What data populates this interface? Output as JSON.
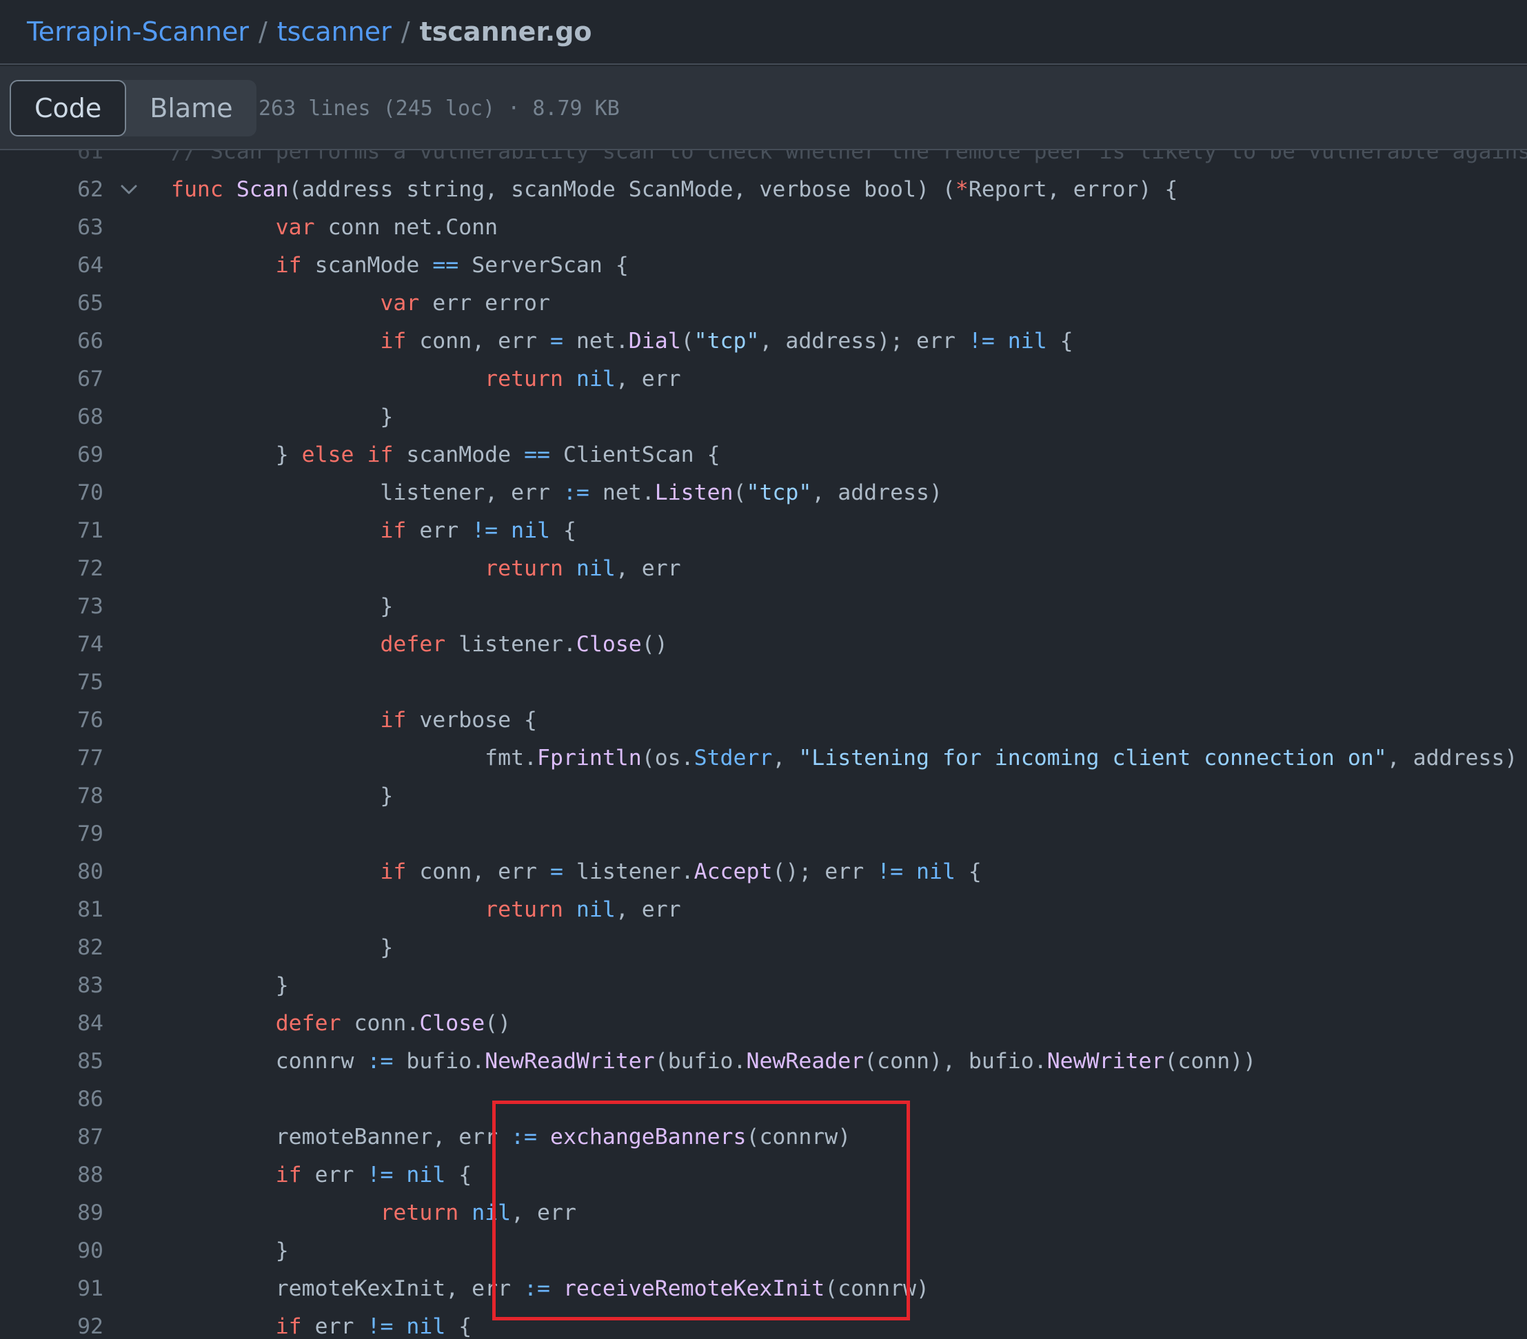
{
  "breadcrumb": {
    "repo": "Terrapin-Scanner",
    "sep1": "/",
    "folder": "tscanner",
    "sep2": "/",
    "file": "tscanner.go"
  },
  "toolbar": {
    "tab_code": "Code",
    "tab_blame": "Blame",
    "file_info": "263 lines (245 loc) · 8.79 KB"
  },
  "colors": {
    "background": "#22272e",
    "keyword": "#f47067",
    "function": "#dcbdfb",
    "constant": "#6cb6ff",
    "string": "#96d0ff",
    "highlight_box": "#e5252c"
  },
  "icons": {
    "fold": "chevron-down-icon"
  },
  "code_lines": [
    {
      "number": "61",
      "faded": true,
      "tokens": [
        [
          "cmt",
          "// Scan performs a vulnerability scan to check whether the remote peer is likely to be vulnerable against prefix truncation"
        ]
      ]
    },
    {
      "number": "62",
      "fold": true,
      "tokens": [
        [
          "kw",
          "func"
        ],
        [
          "pl",
          " "
        ],
        [
          "fn",
          "Scan"
        ],
        [
          "pl",
          "(address string, scanMode ScanMode, verbose bool) ("
        ],
        [
          "kw",
          "*"
        ],
        [
          "pl",
          "Report, error) {"
        ]
      ]
    },
    {
      "number": "63",
      "tokens": [
        [
          "pl",
          "        "
        ],
        [
          "kw",
          "var"
        ],
        [
          "pl",
          " conn net.Conn"
        ]
      ]
    },
    {
      "number": "64",
      "tokens": [
        [
          "pl",
          "        "
        ],
        [
          "kw",
          "if"
        ],
        [
          "pl",
          " scanMode "
        ],
        [
          "const",
          "=="
        ],
        [
          "pl",
          " ServerScan {"
        ]
      ]
    },
    {
      "number": "65",
      "tokens": [
        [
          "pl",
          "                "
        ],
        [
          "kw",
          "var"
        ],
        [
          "pl",
          " err error"
        ]
      ]
    },
    {
      "number": "66",
      "tokens": [
        [
          "pl",
          "                "
        ],
        [
          "kw",
          "if"
        ],
        [
          "pl",
          " conn, err "
        ],
        [
          "const",
          "="
        ],
        [
          "pl",
          " net."
        ],
        [
          "fn",
          "Dial"
        ],
        [
          "pl",
          "("
        ],
        [
          "str",
          "\"tcp\""
        ],
        [
          "pl",
          ", address); err "
        ],
        [
          "const",
          "!="
        ],
        [
          "pl",
          " "
        ],
        [
          "const",
          "nil"
        ],
        [
          "pl",
          " {"
        ]
      ]
    },
    {
      "number": "67",
      "tokens": [
        [
          "pl",
          "                        "
        ],
        [
          "kw",
          "return"
        ],
        [
          "pl",
          " "
        ],
        [
          "const",
          "nil"
        ],
        [
          "pl",
          ", err"
        ]
      ]
    },
    {
      "number": "68",
      "tokens": [
        [
          "pl",
          "                }"
        ]
      ]
    },
    {
      "number": "69",
      "tokens": [
        [
          "pl",
          "        } "
        ],
        [
          "kw",
          "else"
        ],
        [
          "pl",
          " "
        ],
        [
          "kw",
          "if"
        ],
        [
          "pl",
          " scanMode "
        ],
        [
          "const",
          "=="
        ],
        [
          "pl",
          " ClientScan {"
        ]
      ]
    },
    {
      "number": "70",
      "tokens": [
        [
          "pl",
          "                listener, err "
        ],
        [
          "const",
          ":="
        ],
        [
          "pl",
          " net."
        ],
        [
          "fn",
          "Listen"
        ],
        [
          "pl",
          "("
        ],
        [
          "str",
          "\"tcp\""
        ],
        [
          "pl",
          ", address)"
        ]
      ]
    },
    {
      "number": "71",
      "tokens": [
        [
          "pl",
          "                "
        ],
        [
          "kw",
          "if"
        ],
        [
          "pl",
          " err "
        ],
        [
          "const",
          "!="
        ],
        [
          "pl",
          " "
        ],
        [
          "const",
          "nil"
        ],
        [
          "pl",
          " {"
        ]
      ]
    },
    {
      "number": "72",
      "tokens": [
        [
          "pl",
          "                        "
        ],
        [
          "kw",
          "return"
        ],
        [
          "pl",
          " "
        ],
        [
          "const",
          "nil"
        ],
        [
          "pl",
          ", err"
        ]
      ]
    },
    {
      "number": "73",
      "tokens": [
        [
          "pl",
          "                }"
        ]
      ]
    },
    {
      "number": "74",
      "tokens": [
        [
          "pl",
          "                "
        ],
        [
          "kw",
          "defer"
        ],
        [
          "pl",
          " listener."
        ],
        [
          "fn",
          "Close"
        ],
        [
          "pl",
          "()"
        ]
      ]
    },
    {
      "number": "75",
      "tokens": []
    },
    {
      "number": "76",
      "tokens": [
        [
          "pl",
          "                "
        ],
        [
          "kw",
          "if"
        ],
        [
          "pl",
          " verbose {"
        ]
      ]
    },
    {
      "number": "77",
      "tokens": [
        [
          "pl",
          "                        fmt."
        ],
        [
          "fn",
          "Fprintln"
        ],
        [
          "pl",
          "(os."
        ],
        [
          "const",
          "Stderr"
        ],
        [
          "pl",
          ", "
        ],
        [
          "str",
          "\"Listening for incoming client connection on\""
        ],
        [
          "pl",
          ", address)"
        ]
      ]
    },
    {
      "number": "78",
      "tokens": [
        [
          "pl",
          "                }"
        ]
      ]
    },
    {
      "number": "79",
      "tokens": []
    },
    {
      "number": "80",
      "tokens": [
        [
          "pl",
          "                "
        ],
        [
          "kw",
          "if"
        ],
        [
          "pl",
          " conn, err "
        ],
        [
          "const",
          "="
        ],
        [
          "pl",
          " listener."
        ],
        [
          "fn",
          "Accept"
        ],
        [
          "pl",
          "(); err "
        ],
        [
          "const",
          "!="
        ],
        [
          "pl",
          " "
        ],
        [
          "const",
          "nil"
        ],
        [
          "pl",
          " {"
        ]
      ]
    },
    {
      "number": "81",
      "tokens": [
        [
          "pl",
          "                        "
        ],
        [
          "kw",
          "return"
        ],
        [
          "pl",
          " "
        ],
        [
          "const",
          "nil"
        ],
        [
          "pl",
          ", err"
        ]
      ]
    },
    {
      "number": "82",
      "tokens": [
        [
          "pl",
          "                }"
        ]
      ]
    },
    {
      "number": "83",
      "tokens": [
        [
          "pl",
          "        }"
        ]
      ]
    },
    {
      "number": "84",
      "tokens": [
        [
          "pl",
          "        "
        ],
        [
          "kw",
          "defer"
        ],
        [
          "pl",
          " conn."
        ],
        [
          "fn",
          "Close"
        ],
        [
          "pl",
          "()"
        ]
      ]
    },
    {
      "number": "85",
      "tokens": [
        [
          "pl",
          "        connrw "
        ],
        [
          "const",
          ":="
        ],
        [
          "pl",
          " bufio."
        ],
        [
          "fn",
          "NewReadWriter"
        ],
        [
          "pl",
          "(bufio."
        ],
        [
          "fn",
          "NewReader"
        ],
        [
          "pl",
          "(conn), bufio."
        ],
        [
          "fn",
          "NewWriter"
        ],
        [
          "pl",
          "(conn))"
        ]
      ]
    },
    {
      "number": "86",
      "tokens": []
    },
    {
      "number": "87",
      "tokens": [
        [
          "pl",
          "        remoteBanner, err "
        ],
        [
          "const",
          ":="
        ],
        [
          "pl",
          " "
        ],
        [
          "fn",
          "exchangeBanners"
        ],
        [
          "pl",
          "(connrw)"
        ]
      ]
    },
    {
      "number": "88",
      "tokens": [
        [
          "pl",
          "        "
        ],
        [
          "kw",
          "if"
        ],
        [
          "pl",
          " err "
        ],
        [
          "const",
          "!="
        ],
        [
          "pl",
          " "
        ],
        [
          "const",
          "nil"
        ],
        [
          "pl",
          " {"
        ]
      ]
    },
    {
      "number": "89",
      "tokens": [
        [
          "pl",
          "                "
        ],
        [
          "kw",
          "return"
        ],
        [
          "pl",
          " "
        ],
        [
          "const",
          "nil"
        ],
        [
          "pl",
          ", err"
        ]
      ]
    },
    {
      "number": "90",
      "tokens": [
        [
          "pl",
          "        }"
        ]
      ]
    },
    {
      "number": "91",
      "tokens": [
        [
          "pl",
          "        remoteKexInit, err "
        ],
        [
          "const",
          ":="
        ],
        [
          "pl",
          " "
        ],
        [
          "fn",
          "receiveRemoteKexInit"
        ],
        [
          "pl",
          "(connrw)"
        ]
      ]
    },
    {
      "number": "92",
      "tokens": [
        [
          "pl",
          "        "
        ],
        [
          "kw",
          "if"
        ],
        [
          "pl",
          " err "
        ],
        [
          "const",
          "!="
        ],
        [
          "pl",
          " "
        ],
        [
          "const",
          "nil"
        ],
        [
          "pl",
          " {"
        ]
      ]
    }
  ]
}
